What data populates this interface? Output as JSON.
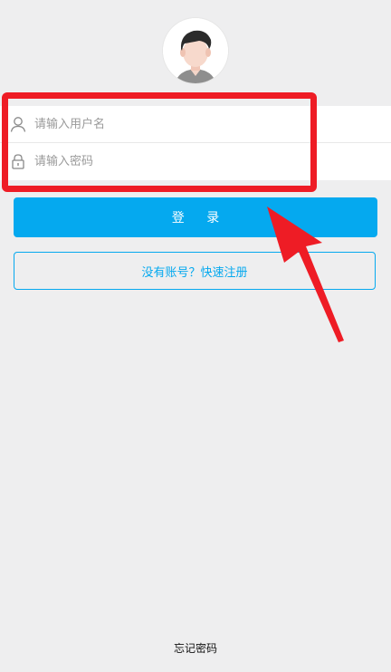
{
  "login_form": {
    "username_placeholder": "请输入用户名",
    "password_placeholder": "请输入密码",
    "login_button_label": "登 录",
    "register_button_label": "没有账号？快速注册",
    "forgot_password_label": "忘记密码"
  },
  "icons": {
    "avatar": "user-avatar-icon",
    "username": "user-icon",
    "password": "lock-icon"
  },
  "colors": {
    "page_background": "#eeeeef",
    "accent_blue": "#05a9ef",
    "highlight_red": "#ee1c25",
    "placeholder_gray": "#9a9a9a"
  }
}
